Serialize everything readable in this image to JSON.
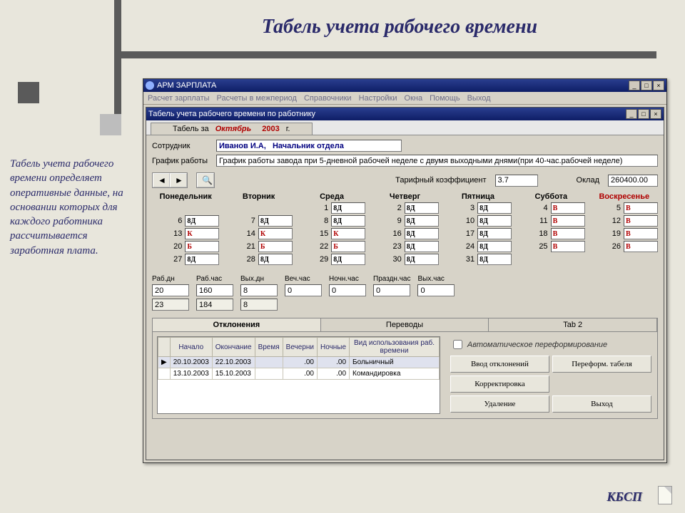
{
  "slide": {
    "title": "Табель учета рабочего времени",
    "side_text": "Табель учета рабочего времени определяет оперативные данные, на основании которых для каждого работника рассчитывается заработная плата.",
    "footer": "КБСП"
  },
  "app": {
    "title": "АРМ ЗАРПЛАТА",
    "menu": [
      "Расчет зарплаты",
      "Расчеты в межпериод",
      "Справочники",
      "Настройки",
      "Окна",
      "Помощь",
      "Выход"
    ],
    "win_buttons": {
      "min": "_",
      "max": "□",
      "close": "×"
    }
  },
  "child": {
    "title": "Табель учета рабочего времени по работнику",
    "tab_prefix": "Табель за",
    "month": "Октябрь",
    "year": "2003",
    "year_suffix": "г.",
    "win_buttons": {
      "min": "_",
      "max": "□",
      "close": "×"
    }
  },
  "fields": {
    "employee_label": "Сотрудник",
    "employee_value": "Иванов И.А,   Начальник отдела",
    "schedule_label": "График работы",
    "schedule_value": "График работы завода при 5-дневной рабочей неделе с двумя выходными днями(при 40-час.рабочей неделе)",
    "tariff_label": "Тарифный коэффициент",
    "tariff_value": "3.7",
    "salary_label": "Оклад",
    "salary_value": "260400.00"
  },
  "days_of_week": [
    "Понедельник",
    "Вторник",
    "Среда",
    "Четверг",
    "Пятница",
    "Суббота",
    "Воскресенье"
  ],
  "calendar": [
    [
      null,
      null,
      {
        "d": "1",
        "v": "8Д"
      },
      {
        "d": "2",
        "v": "8Д"
      },
      {
        "d": "3",
        "v": "8Д"
      },
      {
        "d": "4",
        "v": "В",
        "we": true
      },
      {
        "d": "5",
        "v": "В",
        "we": true
      }
    ],
    [
      {
        "d": "6",
        "v": "8Д"
      },
      {
        "d": "7",
        "v": "8Д"
      },
      {
        "d": "8",
        "v": "8Д"
      },
      {
        "d": "9",
        "v": "8Д"
      },
      {
        "d": "10",
        "v": "8Д"
      },
      {
        "d": "11",
        "v": "В",
        "we": true
      },
      {
        "d": "12",
        "v": "В",
        "we": true
      }
    ],
    [
      {
        "d": "13",
        "v": "К",
        "k": true
      },
      {
        "d": "14",
        "v": "К",
        "k": true
      },
      {
        "d": "15",
        "v": "К",
        "k": true
      },
      {
        "d": "16",
        "v": "8Д"
      },
      {
        "d": "17",
        "v": "8Д"
      },
      {
        "d": "18",
        "v": "В",
        "we": true
      },
      {
        "d": "19",
        "v": "В",
        "we": true
      }
    ],
    [
      {
        "d": "20",
        "v": "Б",
        "k": true
      },
      {
        "d": "21",
        "v": "Б",
        "k": true
      },
      {
        "d": "22",
        "v": "Б",
        "k": true
      },
      {
        "d": "23",
        "v": "8Д"
      },
      {
        "d": "24",
        "v": "8Д"
      },
      {
        "d": "25",
        "v": "В",
        "we": true
      },
      {
        "d": "26",
        "v": "В",
        "we": true
      }
    ],
    [
      {
        "d": "27",
        "v": "8Д"
      },
      {
        "d": "28",
        "v": "8Д"
      },
      {
        "d": "29",
        "v": "8Д"
      },
      {
        "d": "30",
        "v": "8Д"
      },
      {
        "d": "31",
        "v": "8Д"
      },
      null,
      null
    ]
  ],
  "totals": {
    "headers": [
      "Раб.дн",
      "Раб.час",
      "Вых.дн",
      "Веч.час",
      "Ночн.час",
      "Праздн.час",
      "Вых.час"
    ],
    "row1": [
      "20",
      "160",
      "8",
      "0",
      "0",
      "0",
      "0"
    ],
    "row2": [
      "23",
      "184",
      "8"
    ]
  },
  "lower": {
    "tabs": [
      "Отклонения",
      "Переводы",
      "Tab 2"
    ],
    "columns": [
      "Начало",
      "Окончание",
      "Время",
      "Вечерни",
      "Ночные",
      "Вид использования раб. времени"
    ],
    "rows": [
      {
        "start": "20.10.2003",
        "end": "22.10.2003",
        "t": "",
        "e": ".00",
        "n": ".00",
        "desc": "Больничный",
        "sel": true
      },
      {
        "start": "13.10.2003",
        "end": "15.10.2003",
        "t": "",
        "e": ".00",
        "n": ".00",
        "desc": "Командировка"
      }
    ],
    "auto_label": "Автоматическое переформирование",
    "buttons": {
      "add": "Ввод отклонений",
      "reform": "Переформ. табеля",
      "edit": "Корректировка",
      "delete": "Удаление",
      "exit": "Выход"
    }
  }
}
